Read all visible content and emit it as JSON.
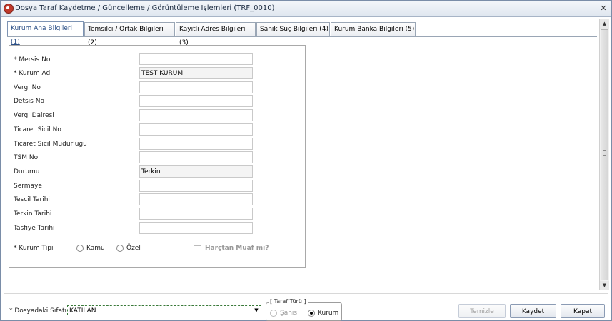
{
  "window": {
    "title": "Dosya Taraf Kaydetme / Güncelleme / Görüntüleme İşlemleri (TRF_0010)",
    "close_icon": "close-icon"
  },
  "tabs": [
    {
      "label": "Kurum Ana Bilgileri (1)",
      "active": true
    },
    {
      "label": "Temsilci / Ortak Bilgileri (2)",
      "active": false
    },
    {
      "label": "Kayıtlı Adres Bilgileri (3)",
      "active": false
    },
    {
      "label": "Sanık Suç Bilgileri (4)",
      "active": false
    },
    {
      "label": "Kurum Banka Bilgileri (5)",
      "active": false
    }
  ],
  "form": {
    "fields": [
      {
        "label": "* Mersis No",
        "value": ""
      },
      {
        "label": "* Kurum Adı",
        "value": "TEST KURUM"
      },
      {
        "label": "Vergi No",
        "value": ""
      },
      {
        "label": "Detsis No",
        "value": ""
      },
      {
        "label": "Vergi Dairesi",
        "value": ""
      },
      {
        "label": "Ticaret Sicil No",
        "value": ""
      },
      {
        "label": "Ticaret Sicil Müdürlüğü",
        "value": ""
      },
      {
        "label": "TSM No",
        "value": ""
      },
      {
        "label": "Durumu",
        "value": "Terkin"
      },
      {
        "label": "Sermaye",
        "value": ""
      },
      {
        "label": "Tescil Tarihi",
        "value": ""
      },
      {
        "label": "Terkin Tarihi",
        "value": ""
      },
      {
        "label": "Tasfiye Tarihi",
        "value": ""
      }
    ],
    "kurum_tipi": {
      "label": "* Kurum Tipi",
      "option_kamu": "Kamu",
      "option_ozel": "Özel",
      "harc_label": "Harçtan Muaf mı?"
    }
  },
  "bottom": {
    "dosyadaki_sifati_label": "* Dosyadaki Sıfatı",
    "dosyadaki_sifati_value": "KATILAN",
    "taraf_turu_title": "[ Taraf Türü ]",
    "option_sahis": "Şahıs",
    "option_kurum": "Kurum",
    "selected_taraf_turu": "Kurum"
  },
  "buttons": {
    "temizle": "Temizle",
    "kaydet": "Kaydet",
    "kapat": "Kapat"
  }
}
